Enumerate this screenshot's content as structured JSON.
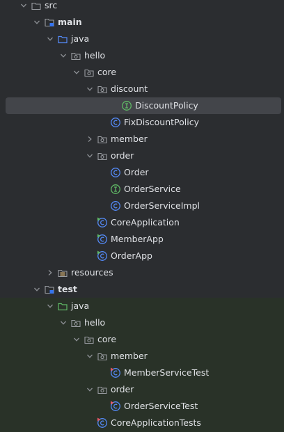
{
  "tree": {
    "src": "src",
    "main": "main",
    "main_java": "java",
    "main_hello": "hello",
    "main_core": "core",
    "discount": "discount",
    "discount_policy": "DiscountPolicy",
    "fix_discount_policy": "FixDiscountPolicy",
    "member": "member",
    "order": "order",
    "order_class": "Order",
    "order_service": "OrderService",
    "order_service_impl": "OrderServiceImpl",
    "core_application": "CoreApplication",
    "member_app": "MemberApp",
    "order_app": "OrderApp",
    "resources": "resources",
    "test": "test",
    "test_java": "java",
    "test_hello": "hello",
    "test_core": "core",
    "test_member": "member",
    "member_service_test": "MemberServiceTest",
    "test_order": "order",
    "order_service_test": "OrderServiceTest",
    "core_application_tests": "CoreApplicationTests"
  },
  "icons": {
    "folder": "folder-icon",
    "package": "package-icon",
    "source_root": "source-root-folder-icon",
    "test_root": "test-root-folder-icon",
    "module": "module-folder-icon",
    "resources": "resources-folder-icon",
    "class": "class-icon",
    "interface": "interface-icon",
    "runnable": "runnable-class-icon",
    "test_class": "test-class-icon"
  },
  "colors": {
    "background": "#2b2d30",
    "selected_row": "#43454a",
    "test_area": "#293228",
    "class_blue": "#548af7",
    "interface_green": "#5fb865",
    "run_red": "#e55765"
  }
}
